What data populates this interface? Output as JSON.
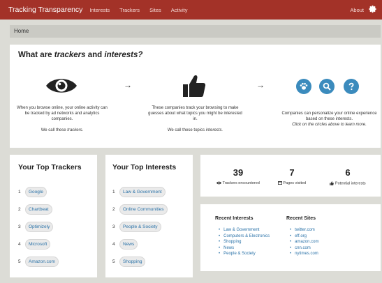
{
  "topbar": {
    "brand": "Tracking Transparency",
    "nav": [
      "Interests",
      "Trackers",
      "Sites",
      "Activity"
    ],
    "about": "About"
  },
  "breadcrumb": "Home",
  "intro": {
    "title_prefix": "What are",
    "title_trackers": "trackers",
    "title_and": "and",
    "title_interests": "interests?",
    "col1_text": "When you browse online, your online activity can be tracked by ad networks and analytics companies.",
    "col1_call_prefix": "We call these",
    "col1_call_term": "trackers.",
    "col2_text": "These companies track your browsing to make guesses about what topics you might be interested in.",
    "col2_call_prefix": "We call these topics",
    "col2_call_term": "interests.",
    "col3_text": "Companies can personalize your online experience based on these interests.",
    "col3_italic": "Click on the circles above to learn more.",
    "arrow": "→"
  },
  "top_trackers": {
    "title": "Your Top Trackers",
    "items": [
      {
        "num": "1",
        "label": "Google"
      },
      {
        "num": "2",
        "label": "Chartbeat"
      },
      {
        "num": "3",
        "label": "Optimizely"
      },
      {
        "num": "4",
        "label": "Microsoft"
      },
      {
        "num": "5",
        "label": "Amazon.com"
      }
    ]
  },
  "top_interests": {
    "title": "Your Top Interests",
    "items": [
      {
        "num": "1",
        "label": "Law & Government"
      },
      {
        "num": "2",
        "label": "Online Communities"
      },
      {
        "num": "3",
        "label": "People & Society"
      },
      {
        "num": "4",
        "label": "News"
      },
      {
        "num": "5",
        "label": "Shopping"
      }
    ]
  },
  "stats": {
    "trackers": {
      "value": "39",
      "label": "Trackers encountered",
      "icon": "eye-icon"
    },
    "pages": {
      "value": "7",
      "label": "Pages visited",
      "icon": "window-icon"
    },
    "interests": {
      "value": "6",
      "label": "Potential interests",
      "icon": "thumbs-up-icon"
    }
  },
  "recent": {
    "interests_title": "Recent Interests",
    "interests": [
      "Law & Government",
      "Computers & Electronics",
      "Shopping",
      "News",
      "People & Society"
    ],
    "sites_title": "Recent Sites",
    "sites": [
      "twitter.com",
      "eff.org",
      "amazon.com",
      "cnn.com",
      "nytimes.com"
    ]
  },
  "colors": {
    "topbar": "#a33228",
    "accent": "#3b8bbd",
    "link": "#2a72a8",
    "background": "#dcdcd6"
  }
}
